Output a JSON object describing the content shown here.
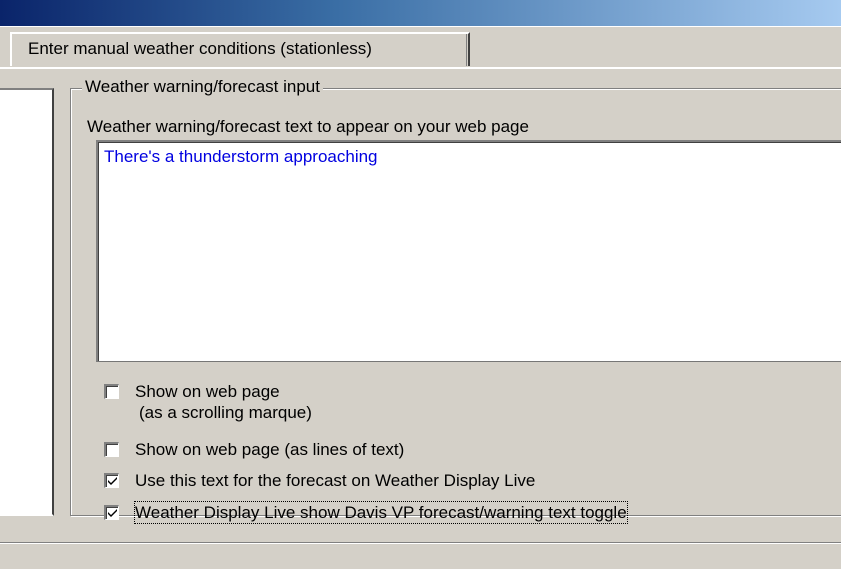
{
  "tab": {
    "label": "Enter manual weather conditions (stationless)"
  },
  "group": {
    "title": "Weather warning/forecast input",
    "field_label": "Weather warning/forecast text to appear on your web page",
    "text_value": "There's a thunderstorm approaching"
  },
  "checkboxes": [
    {
      "label": "Show on web page",
      "sublabel": "(as a scrolling marque)",
      "checked": false
    },
    {
      "label": "Show on web page (as lines of text)",
      "checked": false
    },
    {
      "label": "Use this text for the forecast on Weather Display Live",
      "checked": true
    },
    {
      "label": "Weather Display Live show Davis VP forecast/warning text  toggle",
      "checked": true
    }
  ],
  "colors": {
    "text_input": "#0000e0",
    "face": "#d4d0c8"
  }
}
